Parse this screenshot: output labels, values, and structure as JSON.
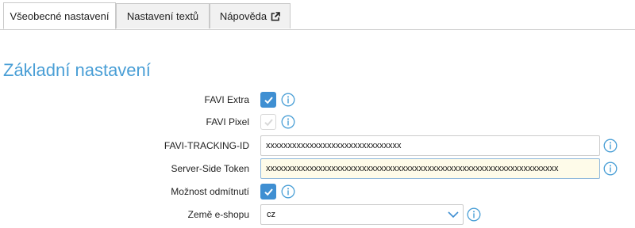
{
  "tabs": [
    {
      "label": "Všeobecné nastavení",
      "active": true
    },
    {
      "label": "Nastavení textů",
      "active": false
    },
    {
      "label": "Nápověda",
      "active": false,
      "icon": "external-link-icon"
    }
  ],
  "section": {
    "title": "Základní nastavení"
  },
  "colors": {
    "accent": "#4a9fd6",
    "checkbox_checked": "#3f8fd2",
    "highlight_bg": "#fefbe9"
  },
  "form": {
    "favi_extra": {
      "label": "FAVI Extra",
      "checked": true
    },
    "favi_pixel": {
      "label": "FAVI Pixel",
      "checked": false
    },
    "tracking_id": {
      "label": "FAVI-TRACKING-ID",
      "value": "xxxxxxxxxxxxxxxxxxxxxxxxxxxxxxx"
    },
    "server_token": {
      "label": "Server-Side Token",
      "value": "xxxxxxxxxxxxxxxxxxxxxxxxxxxxxxxxxxxxxxxxxxxxxxxxxxxxxxxxxxxxxxxxxxx"
    },
    "opt_out": {
      "label": "Možnost odmítnutí",
      "checked": true
    },
    "country": {
      "label": "Země e-shopu",
      "value": "cz"
    }
  }
}
